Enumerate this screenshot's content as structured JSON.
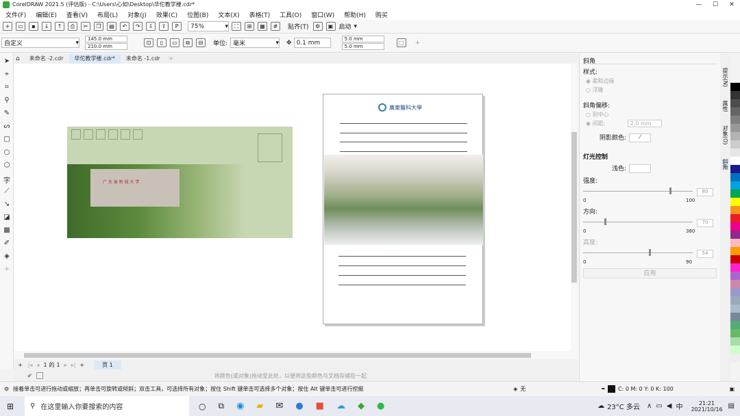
{
  "title": "CorelDRAW 2021.5 (评估版) - C:\\Users\\心如\\Desktop\\华佗教学楼.cdr*",
  "menu": [
    "文件(F)",
    "编辑(E)",
    "查看(V)",
    "布局(L)",
    "对象(J)",
    "效果(C)",
    "位图(B)",
    "文本(X)",
    "表格(T)",
    "工具(O)",
    "窗口(W)",
    "帮助(H)",
    "购买"
  ],
  "stdbar": {
    "zoom": "75%",
    "snap": "贴齐(T)",
    "launch": "启动"
  },
  "propbar": {
    "preset": "自定义",
    "width": "145.0 mm",
    "height": "210.0 mm",
    "unit_label": "单位:",
    "unit": "毫米",
    "nudge": "0.1 mm",
    "dup_x": "5.0 mm",
    "dup_y": "5.0 mm"
  },
  "tabs": [
    "未命名 -2.cdr",
    "华佗教学楼.cdr*",
    "未命名 -1.cdr"
  ],
  "page_nav": {
    "page": "1",
    "of": "的",
    "total": "1",
    "tab": "页 1"
  },
  "palette_hint": "将颜色(或对象)拖动至此处，以便将这些颜色与文档存储在一起",
  "docker": {
    "title": "斜角",
    "style": "样式:",
    "style_opt1": "柔和边缘",
    "style_opt2": "浮雕",
    "offset": "斜角偏移:",
    "offset_opt1": "到中心",
    "offset_opt2": "间距:",
    "offset_val": "2.0 mm",
    "shadow_color": "阴影颜色:",
    "light": "灯光控制",
    "light_color": "浅色:",
    "intensity": "强度:",
    "intensity_val": "80",
    "intensity_min": "0",
    "intensity_max": "100",
    "direction": "方向:",
    "direction_val": "70",
    "direction_min": "0",
    "direction_max": "360",
    "altitude": "高度:",
    "altitude_val": "54",
    "altitude_min": "0",
    "altitude_max": "90",
    "apply": "应用"
  },
  "side_tabs": [
    "提示(N)",
    "属性",
    "对象(O)",
    "斜角"
  ],
  "palette_colors": [
    "#000000",
    "#333333",
    "#4d4d4d",
    "#666666",
    "#808080",
    "#999999",
    "#b3b3b3",
    "#cccccc",
    "#e6e6e6",
    "#ffffff",
    "#1a1a8c",
    "#0070c0",
    "#00a3e0",
    "#00a651",
    "#ffff00",
    "#f7941d",
    "#ed1c24",
    "#ec008c",
    "#92278f",
    "#fbb",
    "#f90",
    "#c00",
    "#f2c",
    "#a6c",
    "#c8a",
    "#99c",
    "#9ab",
    "#abc",
    "#789",
    "#5a7",
    "#6b6",
    "#ada",
    "#cfc",
    "#eee"
  ],
  "status": {
    "hint": "接着单击可进行拖动或缩放；再单击可旋转或倾斜；双击工具，可选择所有对象；按住 Shift 键单击可选择多个对象；按住 Alt 键单击可进行挖掘",
    "fill": "无",
    "cmyk": "C: 0 M: 0 Y: 0 K: 100"
  },
  "envelope_sign": "广 东 省 附 城 大 学",
  "page_logo": "廣東醫科大學",
  "taskbar": {
    "search": "在这里输入你要搜索的内容",
    "weather": "23°C 多云",
    "ime": "中",
    "time": "21:21",
    "date": "2021/10/16"
  }
}
